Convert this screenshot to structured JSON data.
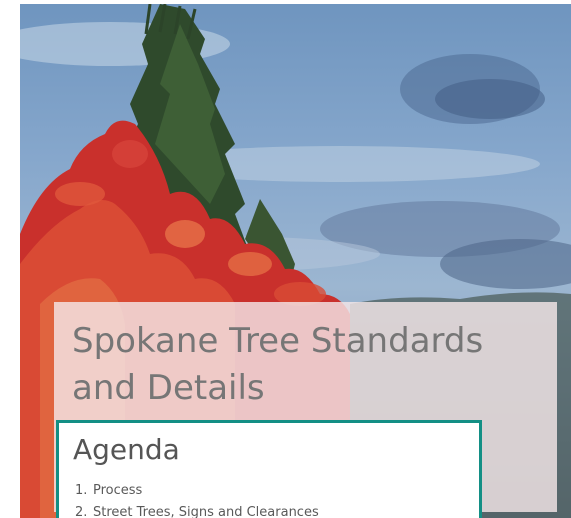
{
  "slide": {
    "title_line1": "Spokane Tree Standards",
    "title_line2": "and Details"
  },
  "agenda": {
    "heading": "Agenda",
    "items": [
      {
        "number": "1.",
        "label": "Process"
      },
      {
        "number": "2.",
        "label": "Street Trees, Signs and Clearances"
      }
    ]
  },
  "colors": {
    "accent_border": "#138f85",
    "title_text": "#767676",
    "panel": "#f4e6e8"
  }
}
